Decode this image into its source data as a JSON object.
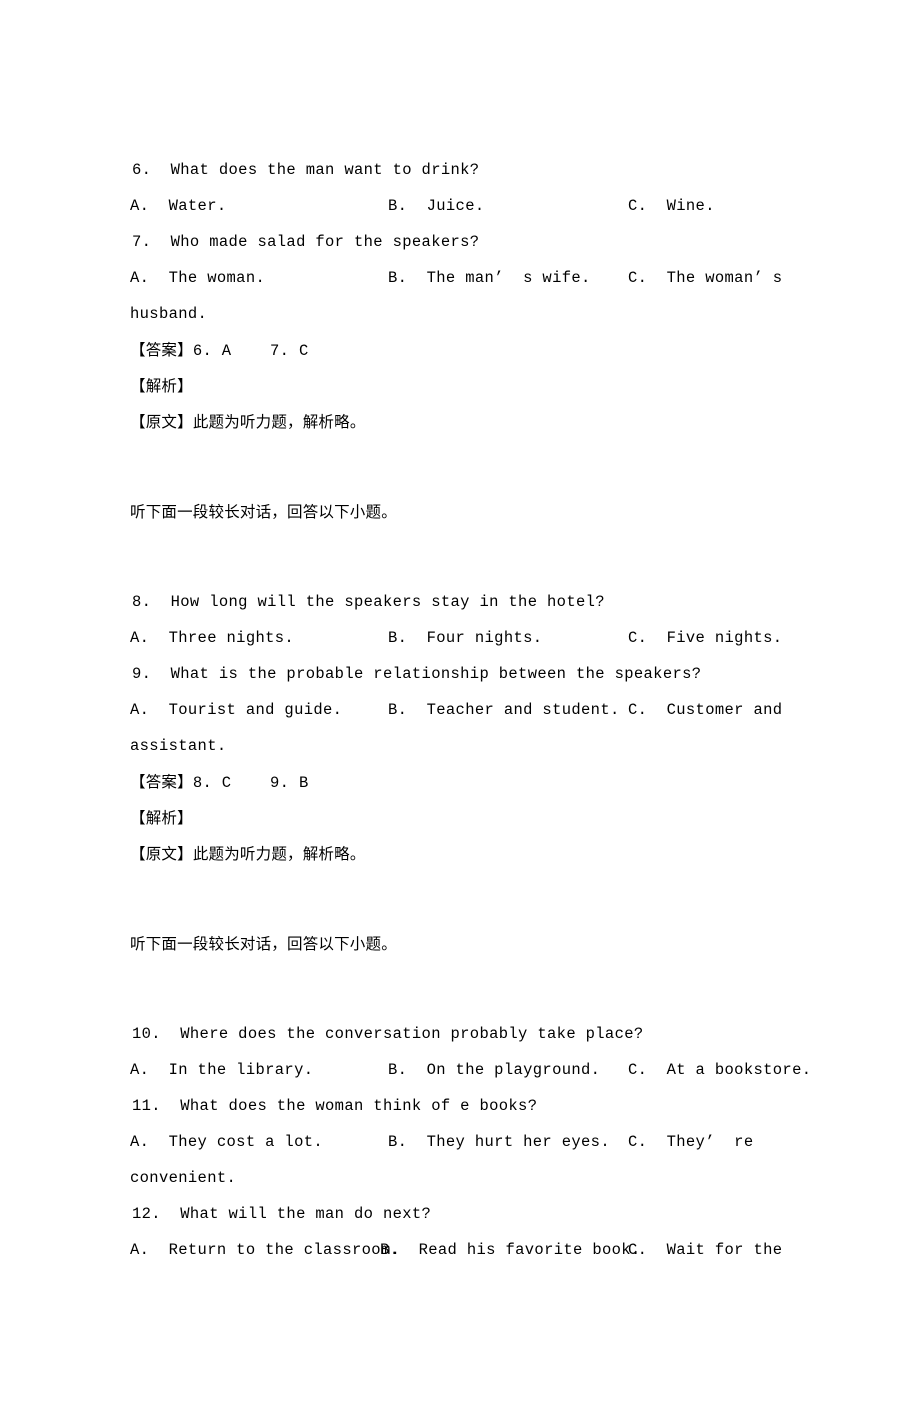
{
  "page": {
    "background_color": "#ffffff",
    "text_color": "#000000"
  },
  "blocks": [
    {
      "id": "block-6-7",
      "questions": [
        {
          "number": "6.",
          "stem": "6.  What does the man want to drink?",
          "options": [
            "A.  Water.",
            "B.  Juice.",
            "C.  Wine."
          ],
          "continuation": ""
        },
        {
          "number": "7.",
          "stem": "7.  Who made salad for the speakers?",
          "options": [
            "A.  The woman.",
            "B.  The man’  s wife.",
            "C.  The woman’ s"
          ],
          "continuation": "husband."
        }
      ],
      "answer_line": "【答案】6. A    7. C",
      "answer_label": "【答案】",
      "answer_values": "6. A    7. C",
      "analysis_label": "【解析】",
      "transcript_label": "【原文】",
      "transcript_text": "此题为听力题，解析略。"
    },
    {
      "id": "block-8-9",
      "questions": [
        {
          "number": "8.",
          "stem": "8.  How long will the speakers stay in the hotel?",
          "options": [
            "A.  Three nights.",
            "B.  Four nights.",
            "C.  Five nights."
          ],
          "continuation": ""
        },
        {
          "number": "9.",
          "stem": "9.  What is the probable relationship between the speakers?",
          "options": [
            "A.  Tourist and guide.",
            "B.  Teacher and student.",
            "C.  Customer and"
          ],
          "continuation": "assistant."
        }
      ],
      "answer_label": "【答案】",
      "answer_values": "8. C    9. B",
      "analysis_label": "【解析】",
      "transcript_label": "【原文】",
      "transcript_text": "此题为听力题，解析略。"
    },
    {
      "id": "block-10-12",
      "questions": [
        {
          "number": "10.",
          "stem": "10.  Where does the conversation probably take place?",
          "options": [
            "A.  In the library.",
            "B.  On the playground.",
            "C.  At a bookstore."
          ],
          "continuation": ""
        },
        {
          "number": "11.",
          "stem": "11.  What does the woman think of e books?",
          "options": [
            "A.  They cost a lot.",
            "B.  They hurt her eyes.",
            "C.  They’  re"
          ],
          "continuation": "convenient."
        },
        {
          "number": "12.",
          "stem": "12.  What will the man do next?",
          "options": [
            "A.  Return to the classroom.",
            "B.  Read his favorite book.",
            "C.  Wait for the"
          ],
          "continuation": ""
        }
      ]
    }
  ],
  "separators": {
    "listening_prompt": "听下面一段较长对话，回答以下小题。"
  }
}
